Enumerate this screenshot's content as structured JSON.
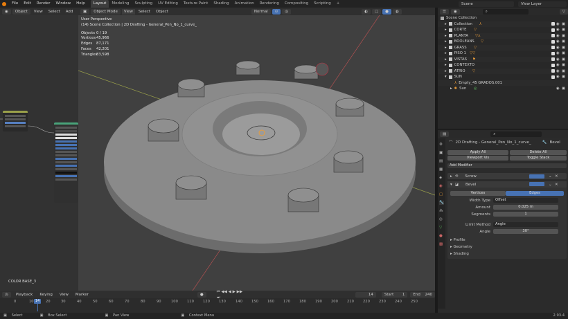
{
  "menu": [
    "File",
    "Edit",
    "Render",
    "Window",
    "Help"
  ],
  "workspaces": [
    "Layout",
    "Modeling",
    "Sculpting",
    "UV Editing",
    "Texture Paint",
    "Shading",
    "Animation",
    "Rendering",
    "Compositing",
    "Scripting"
  ],
  "scene": "Scene",
  "view_layer": "View Layer",
  "viewport_header": {
    "mode": "Object Mode",
    "menus": [
      "View",
      "Select",
      "Object"
    ],
    "orientation": "Normal"
  },
  "sidebar_header": {
    "mode": "Object",
    "menus": [
      "View",
      "Select",
      "Add"
    ]
  },
  "viewport_info": {
    "perspective": "User Perspective",
    "collection": "(14) Scene Collection | 2D Drafting - General_Pen_No_1_curve_",
    "stats": [
      {
        "label": "Objects",
        "value": "0 / 19"
      },
      {
        "label": "Vertices",
        "value": "45,966"
      },
      {
        "label": "Edges",
        "value": "87,171"
      },
      {
        "label": "Faces",
        "value": "42,201"
      },
      {
        "label": "Triangles",
        "value": "83,598"
      }
    ]
  },
  "sidebar_label": "COLOR BASE_3",
  "outliner": {
    "title": "Scene Collection",
    "items": [
      "Collection",
      "CORTE",
      "PLANTA",
      "BOOLEANS",
      "GRASS",
      "PISO 1",
      "VISTAS",
      "CONTEXTO",
      "ATRIO",
      "SUN"
    ],
    "sub_items": [
      "Empty_45 GRADOS.001",
      "Sun"
    ]
  },
  "properties": {
    "object": "2D Drafting - General_Pen_No_1_curve_",
    "modifier_tab": "Bevel",
    "apply_all": "Apply All",
    "delete_all": "Delete All",
    "viewport_vis": "Viewport Vis",
    "toggle_stack": "Toggle Stack",
    "add_modifier": "Add Modifier",
    "modifiers": [
      "Screw",
      "Bevel"
    ],
    "affect": [
      "Vertices",
      "Edges"
    ],
    "fields": [
      {
        "label": "Width Type",
        "value": "Offset"
      },
      {
        "label": "Amount",
        "value": "0.025 m"
      },
      {
        "label": "Segments",
        "value": "1"
      },
      {
        "label": "Limit Method",
        "value": "Angle"
      },
      {
        "label": "Angle",
        "value": "30°"
      }
    ],
    "panels": [
      "Profile",
      "Geometry",
      "Shading"
    ]
  },
  "timeline": {
    "menus": [
      "Playback",
      "Keying",
      "View",
      "Marker"
    ],
    "current_frame": "14",
    "start_label": "Start",
    "start": "1",
    "end_label": "End",
    "end": "240",
    "ticks": [
      "0",
      "10",
      "14",
      "20",
      "30",
      "40",
      "50",
      "60",
      "70",
      "80",
      "90",
      "100",
      "110",
      "120",
      "130",
      "140",
      "150",
      "160",
      "170",
      "180",
      "190",
      "200",
      "210",
      "220",
      "230",
      "240",
      "250"
    ]
  },
  "status": {
    "items": [
      "Select",
      "Box Select",
      "Pan View",
      "Context Menu"
    ],
    "version": "2.93.4"
  },
  "colors": {
    "accent": "#4772b3",
    "orange": "#e89c3a",
    "selection": "#5680c2"
  }
}
